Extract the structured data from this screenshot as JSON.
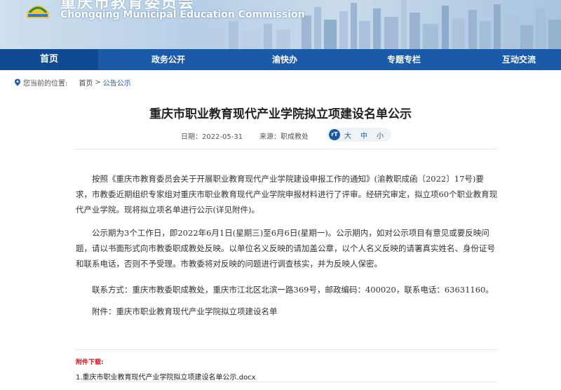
{
  "header": {
    "title_cn": "重庆市教育委员会",
    "title_en": "Chongqing Municipal Education Commission"
  },
  "nav": {
    "items": [
      {
        "label": "首页",
        "active": true
      },
      {
        "label": "政务公开",
        "active": false
      },
      {
        "label": "渝快办",
        "active": false
      },
      {
        "label": "专题专栏",
        "active": false
      },
      {
        "label": "互动交流",
        "active": false
      }
    ]
  },
  "breadcrumb": {
    "prefix": "您当前的位置:",
    "home": "首页",
    "separator": ">",
    "current": "公告公示"
  },
  "article": {
    "title": "重庆市职业教育现代产业学院拟立项建设名单公示",
    "date": "日期：2022-05-31",
    "source": "来源：职成教处",
    "font_size": {
      "icon": "rT",
      "large": "大",
      "medium": "中",
      "small": "小"
    },
    "paragraphs": [
      "按照《重庆市教育委员会关于开展职业教育现代产业学院建设申报工作的通知》(渝教职成函〔2022〕17号)要求，市教委近期组织专家组对重庆市职业教育现代产业学院申报材料进行了评审。经研究审定，拟立项60个职业教育现代产业学院。现将拟立项名单进行公示(详见附件)。",
      "公示期为3个工作日，即2022年6月1日(星期三)至6月6日(星期一)。公示期内，如对公示项目有意见或要反映问题，请以书面形式向市教委职成教处反映。以单位名义反映的请加盖公章，以个人名义反映的请署真实姓名、身份证号和联系电话，否则不予受理。市教委将对反映的问题进行调查核实，并为反映人保密。",
      "联系方式：重庆市教委职成教处，重庆市江北区北滨一路369号，邮政编码：400020，联系电话：63631160。",
      "附件：重庆市职业教育现代产业学院拟立项建设名单"
    ]
  },
  "attachments": {
    "label": "附件下载:",
    "files": [
      "1.重庆市职业教育现代产业学院拟立项建设名单公示.docx"
    ]
  },
  "colors": {
    "nav": "#1a5aa8",
    "accent_red": "#d71920"
  }
}
